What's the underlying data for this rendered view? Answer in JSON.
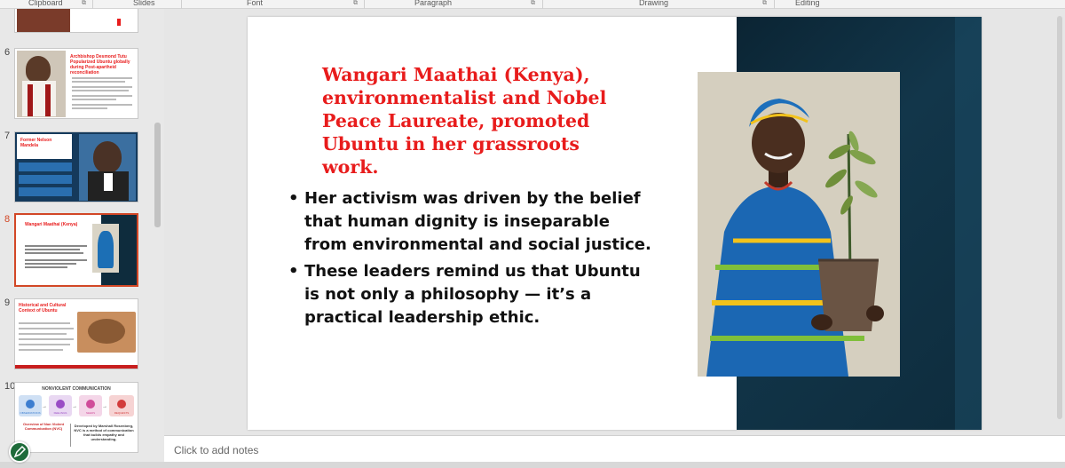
{
  "ribbon": {
    "groups": [
      "Clipboard",
      "Slides",
      "Font",
      "Paragraph",
      "Drawing",
      "Editing"
    ]
  },
  "thumbnails": [
    {
      "number": "6",
      "title": "Archbishop Desmond Tutu Popularized Ubuntu globally during Post-apartheid reconciliation"
    },
    {
      "number": "7",
      "title": "Former Nelson Mandela"
    },
    {
      "number": "8",
      "title": "Wangari Maathai (Kenya)",
      "selected": true
    },
    {
      "number": "9",
      "title": "Historical and Cultural Context of Ubuntu"
    },
    {
      "number": "10",
      "title": "NONVIOLENT COMMUNICATION",
      "steps": [
        "OBSERVATIONS",
        "FEELINGS",
        "NEEDS",
        "REQUESTS"
      ],
      "caption": "Developed by Marshall Rosenberg, NVC is a method of communication that builds empathy and understanding.",
      "side": "Overview of Non Violent Communication (NVC)"
    }
  ],
  "slide": {
    "title": "Wangari Maathai (Kenya), environmentalist and Nobel Peace Laureate, promoted Ubuntu in her grassroots work.",
    "bullets": [
      "Her activism was driven by the belief that human dignity is inseparable from environmental and social justice.",
      "These leaders remind us that Ubuntu is not only a philosophy — it’s a practical leadership ethic."
    ]
  },
  "notes": {
    "placeholder": "Click to add notes"
  },
  "colors": {
    "title_red": "#e81c1c",
    "selection": "#d24726",
    "panel_dark": "#0e2c3d"
  }
}
